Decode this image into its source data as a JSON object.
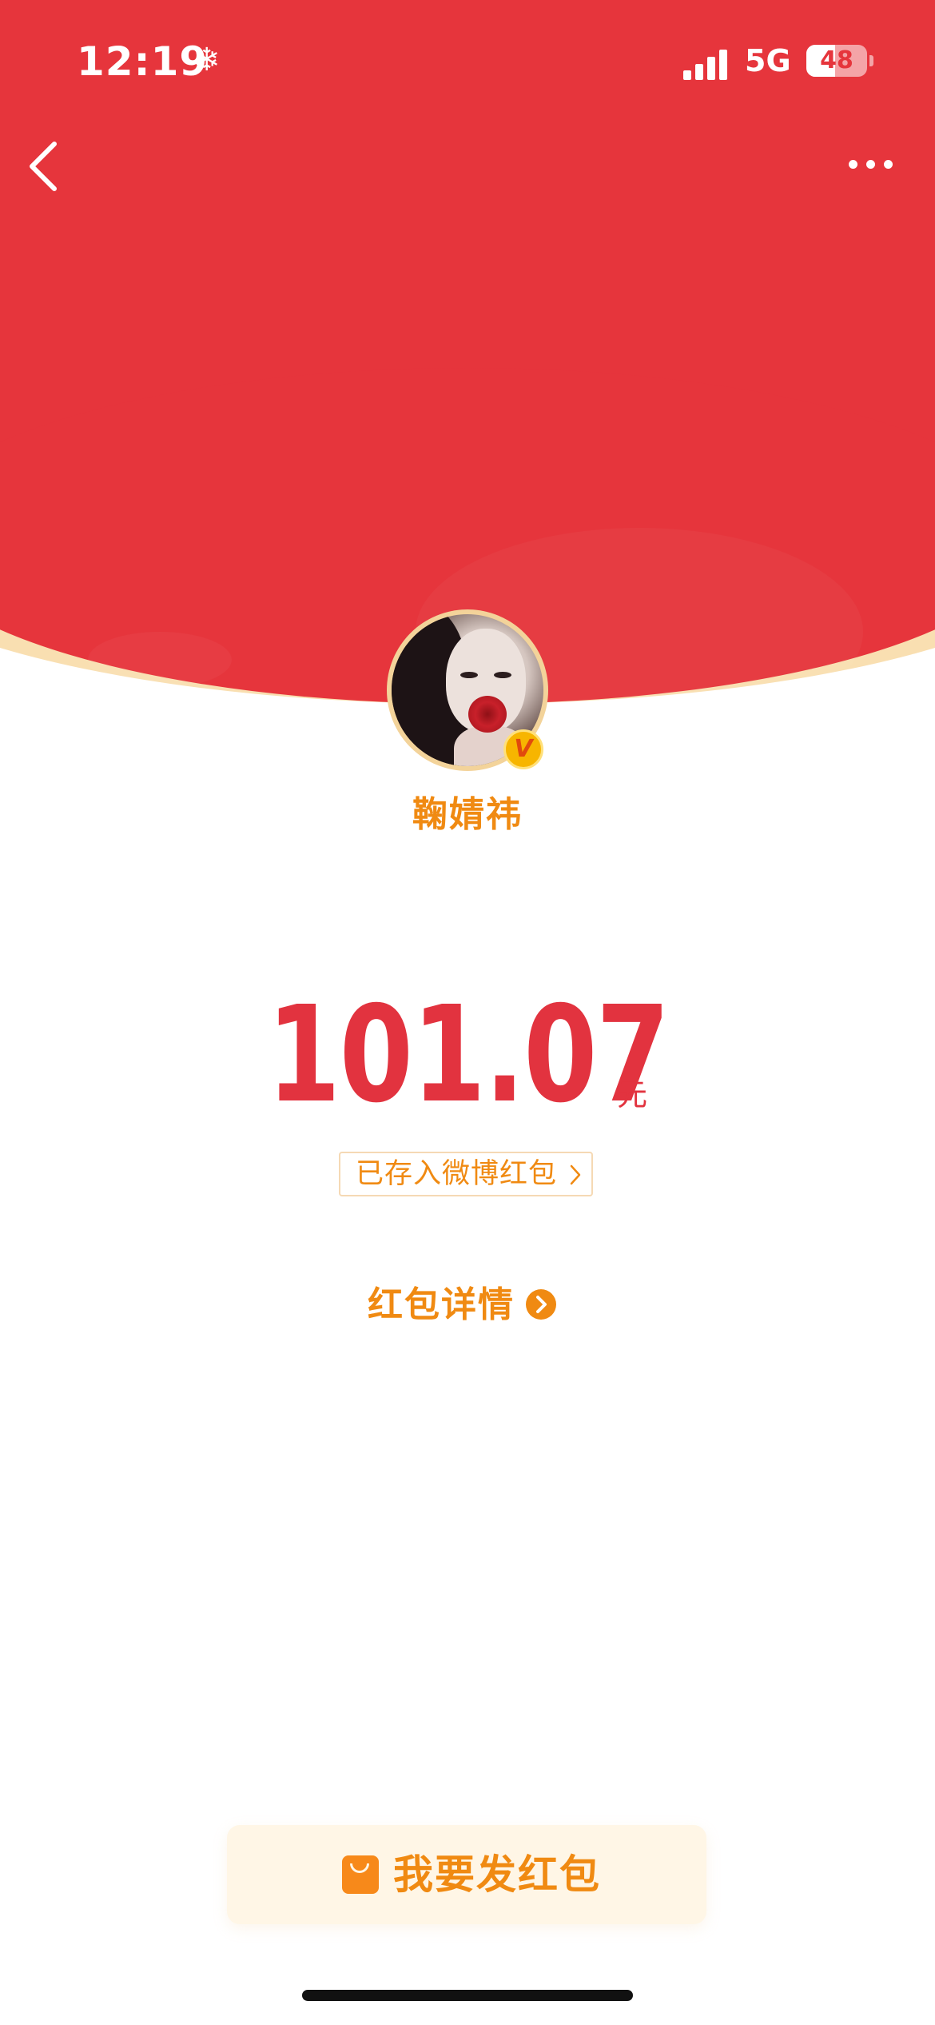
{
  "status_bar": {
    "time": "12:19",
    "status_icon": "snowflake-icon",
    "network": "5G",
    "battery": "48",
    "battery_level": 0.48,
    "signal_bars": 4
  },
  "nav": {
    "back_icon": "chevron-left-icon",
    "more_icon": "more-horizontal-icon"
  },
  "sender": {
    "name": "鞠婧祎",
    "verified": true,
    "avatar_icon": "avatar-photo",
    "badge_icon": "verified-v-icon"
  },
  "amount": {
    "value": "101.07",
    "unit": "元"
  },
  "deposit_link": {
    "label": "已存入微博红包",
    "icon": "chevron-right-icon"
  },
  "details_link": {
    "label": "红包详情",
    "icon": "arrow-right-circle-icon"
  },
  "send_button": {
    "label": "我要发红包",
    "icon": "red-packet-icon"
  },
  "colors": {
    "header_red": "#e6353c",
    "amount_red": "#e2333f",
    "accent_orange": "#f08a12",
    "cream": "#f9dfb1",
    "button_bg": "#fff6e6"
  }
}
